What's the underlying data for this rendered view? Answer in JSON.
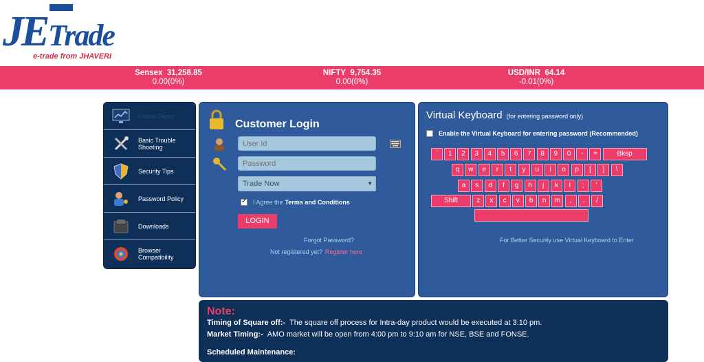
{
  "brand": {
    "logo_text": "JeTrade",
    "tagline": "e-trade from JHAVERI",
    "accent": "#ea3d6a",
    "navy": "#0e2f57",
    "panel": "#2f5a9b"
  },
  "ticker": [
    {
      "name": "Sensex",
      "value": "31,258.85",
      "change": "0.00(0%)"
    },
    {
      "name": "NIFTY",
      "value": "9,754.35",
      "change": "0.00(0%)"
    },
    {
      "name": "USD/INR",
      "value": "64.14",
      "change": "-0.01(0%)"
    }
  ],
  "menu": [
    {
      "label": "Online Demo",
      "icon": "chart-monitor-icon"
    },
    {
      "label": "Basic Trouble Shooting",
      "icon": "tools-icon"
    },
    {
      "label": "Security Tips",
      "icon": "shield-icon"
    },
    {
      "label": "Password Policy",
      "icon": "user-key-icon"
    },
    {
      "label": "Downloads",
      "icon": "download-box-icon"
    },
    {
      "label": "Browser Compatibility",
      "icon": "browsers-icon"
    }
  ],
  "login": {
    "title": "Customer Login",
    "userid_placeholder": "User Id",
    "password_placeholder": "Password",
    "product_selected": "Trade Now",
    "agree_prefix": "I Agree the",
    "agree_link": "Terms and Conditions",
    "login_button": "LOGIN",
    "forgot": "Forgot Password?",
    "not_registered": "Not registered yet?",
    "register": "Register here"
  },
  "keyboard": {
    "title": "Virtual Keyboard",
    "subtitle": "(for entering password only)",
    "enable_label": "Enable the Virtual Keyboard for entering password (Recommended)",
    "row1": [
      "`",
      "1",
      "2",
      "3",
      "4",
      "5",
      "6",
      "7",
      "8",
      "9",
      "0",
      "-",
      "=",
      "Bksp"
    ],
    "row2": [
      "q",
      "w",
      "e",
      "r",
      "t",
      "y",
      "u",
      "i",
      "o",
      "p",
      "[",
      "]",
      "\\"
    ],
    "row3": [
      "a",
      "s",
      "d",
      "f",
      "g",
      "h",
      "j",
      "k",
      "l",
      ";",
      "'"
    ],
    "row4": [
      "Shift",
      "z",
      "x",
      "c",
      "v",
      "b",
      "n",
      "m",
      ",",
      ".",
      "/"
    ],
    "space": "",
    "note": "For Better Security use Virtual Keyboard to Enter"
  },
  "note": {
    "heading": "Note:",
    "l1_label": "Timing of Square off:-",
    "l1_text": "The square off process for Intra-day product would be executed at 3:10 pm.",
    "l2_label": "Market Timing:-",
    "l2_text": "AMO market will be open from 4:00 pm to 9:10 am for NSE, BSE and FONSE.",
    "l3_label": "Scheduled Maintenance:"
  }
}
